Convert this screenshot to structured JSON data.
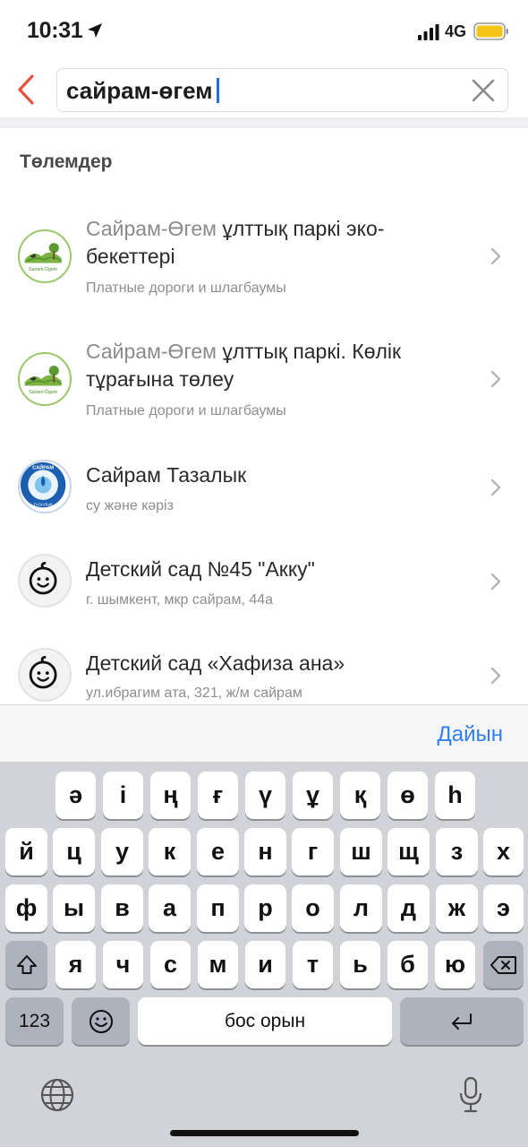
{
  "status": {
    "time": "10:31",
    "network": "4G"
  },
  "search": {
    "value": "сайрам-өгем"
  },
  "section_title": "Төлемдер",
  "results": [
    {
      "title_highlight": "Сайрам-Өгем",
      "title_rest": " ұлттық паркі эко-бекеттері",
      "subtitle": "Платные дороги и шлагбаумы",
      "logo": "sairam-ogem-park-logo"
    },
    {
      "title_highlight": "Сайрам-Өгем",
      "title_rest": " ұлттық паркі. Көлік тұрағына төлеу",
      "subtitle": "Платные дороги и шлагбаумы",
      "logo": "sairam-ogem-park-logo"
    },
    {
      "title_highlight": "",
      "title_rest": "Сайрам Тазалык",
      "subtitle": "су және кәріз",
      "logo": "sairam-tazalyk-logo"
    },
    {
      "title_highlight": "",
      "title_rest": "Детский сад №45 \"Акку\"",
      "subtitle": "г. шымкент, мкр сайрам, 44а",
      "logo": "baby-face-icon"
    },
    {
      "title_highlight": "",
      "title_rest": "Детский сад «Хафиза ана»",
      "subtitle": "ул.ибрагим ата, 321, ж/м сайрам",
      "logo": "baby-face-icon"
    }
  ],
  "logo_texts": {
    "park": "Sairam-Ögem",
    "tazalyk_top": "САЙРАМ",
    "tazalyk_bottom": "ТАЗАЛЫК"
  },
  "keyboard": {
    "done_label": "Дайын",
    "row1": [
      "ә",
      "і",
      "ң",
      "ғ",
      "ү",
      "ұ",
      "қ",
      "ө",
      "һ"
    ],
    "row2": [
      "й",
      "ц",
      "у",
      "к",
      "е",
      "н",
      "г",
      "ш",
      "щ",
      "з",
      "х"
    ],
    "row3": [
      "ф",
      "ы",
      "в",
      "а",
      "п",
      "р",
      "о",
      "л",
      "д",
      "ж",
      "э"
    ],
    "row4": [
      "я",
      "ч",
      "с",
      "м",
      "и",
      "т",
      "ь",
      "б",
      "ю"
    ],
    "numbers_label": "123",
    "space_label": "бос орын"
  },
  "colors": {
    "accent": "#2f7ff0",
    "back": "#e5533d",
    "park_green": "#7cb342",
    "tazalyk_blue": "#1b5fb0"
  }
}
